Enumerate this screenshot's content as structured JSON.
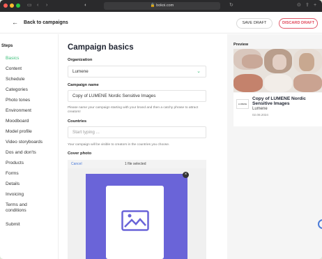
{
  "browser": {
    "url": "bokoi.com",
    "icons": {
      "sidebar": "sidebar-icon",
      "back": "back-arrow-icon",
      "forward": "forward-arrow-icon",
      "shield": "shield-icon",
      "reload": "reload-icon",
      "download": "download-icon",
      "share": "share-icon",
      "new_tab": "plus-icon",
      "lock": "lock-icon"
    },
    "traffic_lights": {
      "close": "#ff5f57",
      "minimize": "#febc2e",
      "maximize": "#28c840"
    }
  },
  "header": {
    "back_label": "Back to campaigns",
    "save_draft": "SAVE DRAFT",
    "discard_draft": "DISCARD DRAFT"
  },
  "sidebar": {
    "heading": "Steps",
    "items": [
      {
        "label": "Basics",
        "active": true
      },
      {
        "label": "Content"
      },
      {
        "label": "Schedule"
      },
      {
        "label": "Categories"
      },
      {
        "label": "Photo tones"
      },
      {
        "label": "Environment"
      },
      {
        "label": "Moodboard"
      },
      {
        "label": "Model profile"
      },
      {
        "label": "Video storyboards"
      },
      {
        "label": "Dos and don'ts"
      },
      {
        "label": "Products"
      },
      {
        "label": "Forms"
      },
      {
        "label": "Details"
      },
      {
        "label": "Invoicing"
      },
      {
        "label": "Terms and conditions"
      },
      {
        "label": "Submit"
      }
    ]
  },
  "main": {
    "title": "Campaign basics",
    "organization_label": "Organization",
    "organization_value": "Lumene",
    "campaign_name_label": "Campaign name",
    "campaign_name_value": "Copy of LUMENE Nordic Sensitive Images",
    "campaign_name_hint": "Please name your campaign starting with your brand and then a catchy phrase to attract creators!",
    "countries_label": "Countries",
    "countries_placeholder": "Start typing ...",
    "countries_hint": "Your campaign will be visible to creators in the countries you choose.",
    "cover_photo_label": "Cover photo",
    "cover_cancel": "Cancel",
    "cover_status": "1 file selected"
  },
  "preview": {
    "heading": "Preview",
    "logo_text": "LUMENE",
    "title": "Copy of LUMENE Nordic Sensitive Images",
    "organization": "Lumene",
    "date": "02.08.2024"
  },
  "colors": {
    "accent": "#3bbf7a",
    "danger": "#e0475a",
    "cover": "#6a64d8"
  }
}
